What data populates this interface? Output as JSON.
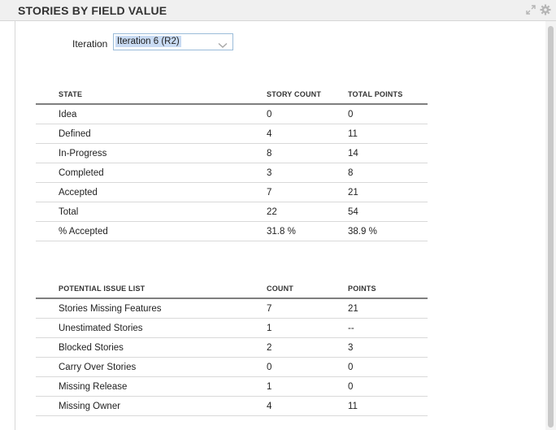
{
  "header": {
    "title": "STORIES BY FIELD VALUE"
  },
  "filter": {
    "label": "Iteration",
    "selected": "Iteration 6 (R2)"
  },
  "state_table": {
    "columns": [
      "STATE",
      "STORY COUNT",
      "TOTAL POINTS"
    ],
    "rows": [
      [
        "Idea",
        "0",
        "0"
      ],
      [
        "Defined",
        "4",
        "11"
      ],
      [
        "In-Progress",
        "8",
        "14"
      ],
      [
        "Completed",
        "3",
        "8"
      ],
      [
        "Accepted",
        "7",
        "21"
      ],
      [
        "Total",
        "22",
        "54"
      ],
      [
        "% Accepted",
        "31.8 %",
        "38.9 %"
      ]
    ]
  },
  "issue_table": {
    "columns": [
      "POTENTIAL ISSUE LIST",
      "COUNT",
      "POINTS"
    ],
    "rows": [
      [
        "Stories Missing Features",
        "7",
        "21"
      ],
      [
        "Unestimated Stories",
        "1",
        "--"
      ],
      [
        "Blocked Stories",
        "2",
        "3"
      ],
      [
        "Carry Over Stories",
        "0",
        "0"
      ],
      [
        "Missing Release",
        "1",
        "0"
      ],
      [
        "Missing Owner",
        "4",
        "11"
      ]
    ]
  }
}
